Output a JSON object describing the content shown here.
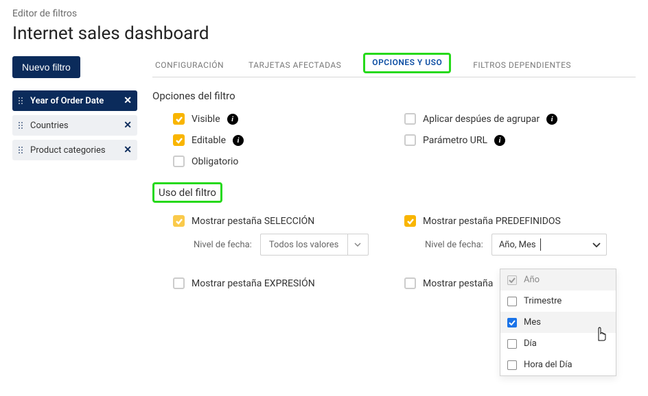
{
  "breadcrumb": "Editor de filtros",
  "title": "Internet sales dashboard",
  "sidebar": {
    "new_filter_btn": "Nuevo filtro",
    "filters": [
      {
        "label": "Year of Order Date",
        "active": true
      },
      {
        "label": "Countries",
        "active": false
      },
      {
        "label": "Product categories",
        "active": false
      }
    ]
  },
  "tabs": {
    "config": "Configuración",
    "cards": "Tarjetas afectadas",
    "options": "Opciones y uso",
    "dependent": "Filtros dependientes"
  },
  "sections": {
    "filter_options": "Opciones del filtro",
    "filter_usage": "Uso del filtro"
  },
  "options": {
    "visible": "Visible",
    "editable": "Editable",
    "mandatory": "Obligatorio",
    "apply_after_group": "Aplicar despúes de agrupar",
    "url_param": "Parámetro URL"
  },
  "usage": {
    "show_selection_tab": "Mostrar pestaña SELECCIÓN",
    "show_predefined_tab": "Mostrar pestaña PREDEFINIDOS",
    "show_expression_tab": "Mostrar pestaña EXPRESIÓN",
    "show_tab_partial": "Mostrar pestaña",
    "date_level_label": "Nivel de fecha:",
    "all_values": "Todos los valores",
    "selected_levels": "Año,   Mes"
  },
  "dropdown": {
    "year": "Año",
    "quarter": "Trimestre",
    "month": "Mes",
    "day": "Día",
    "hour": "Hora del Día"
  }
}
